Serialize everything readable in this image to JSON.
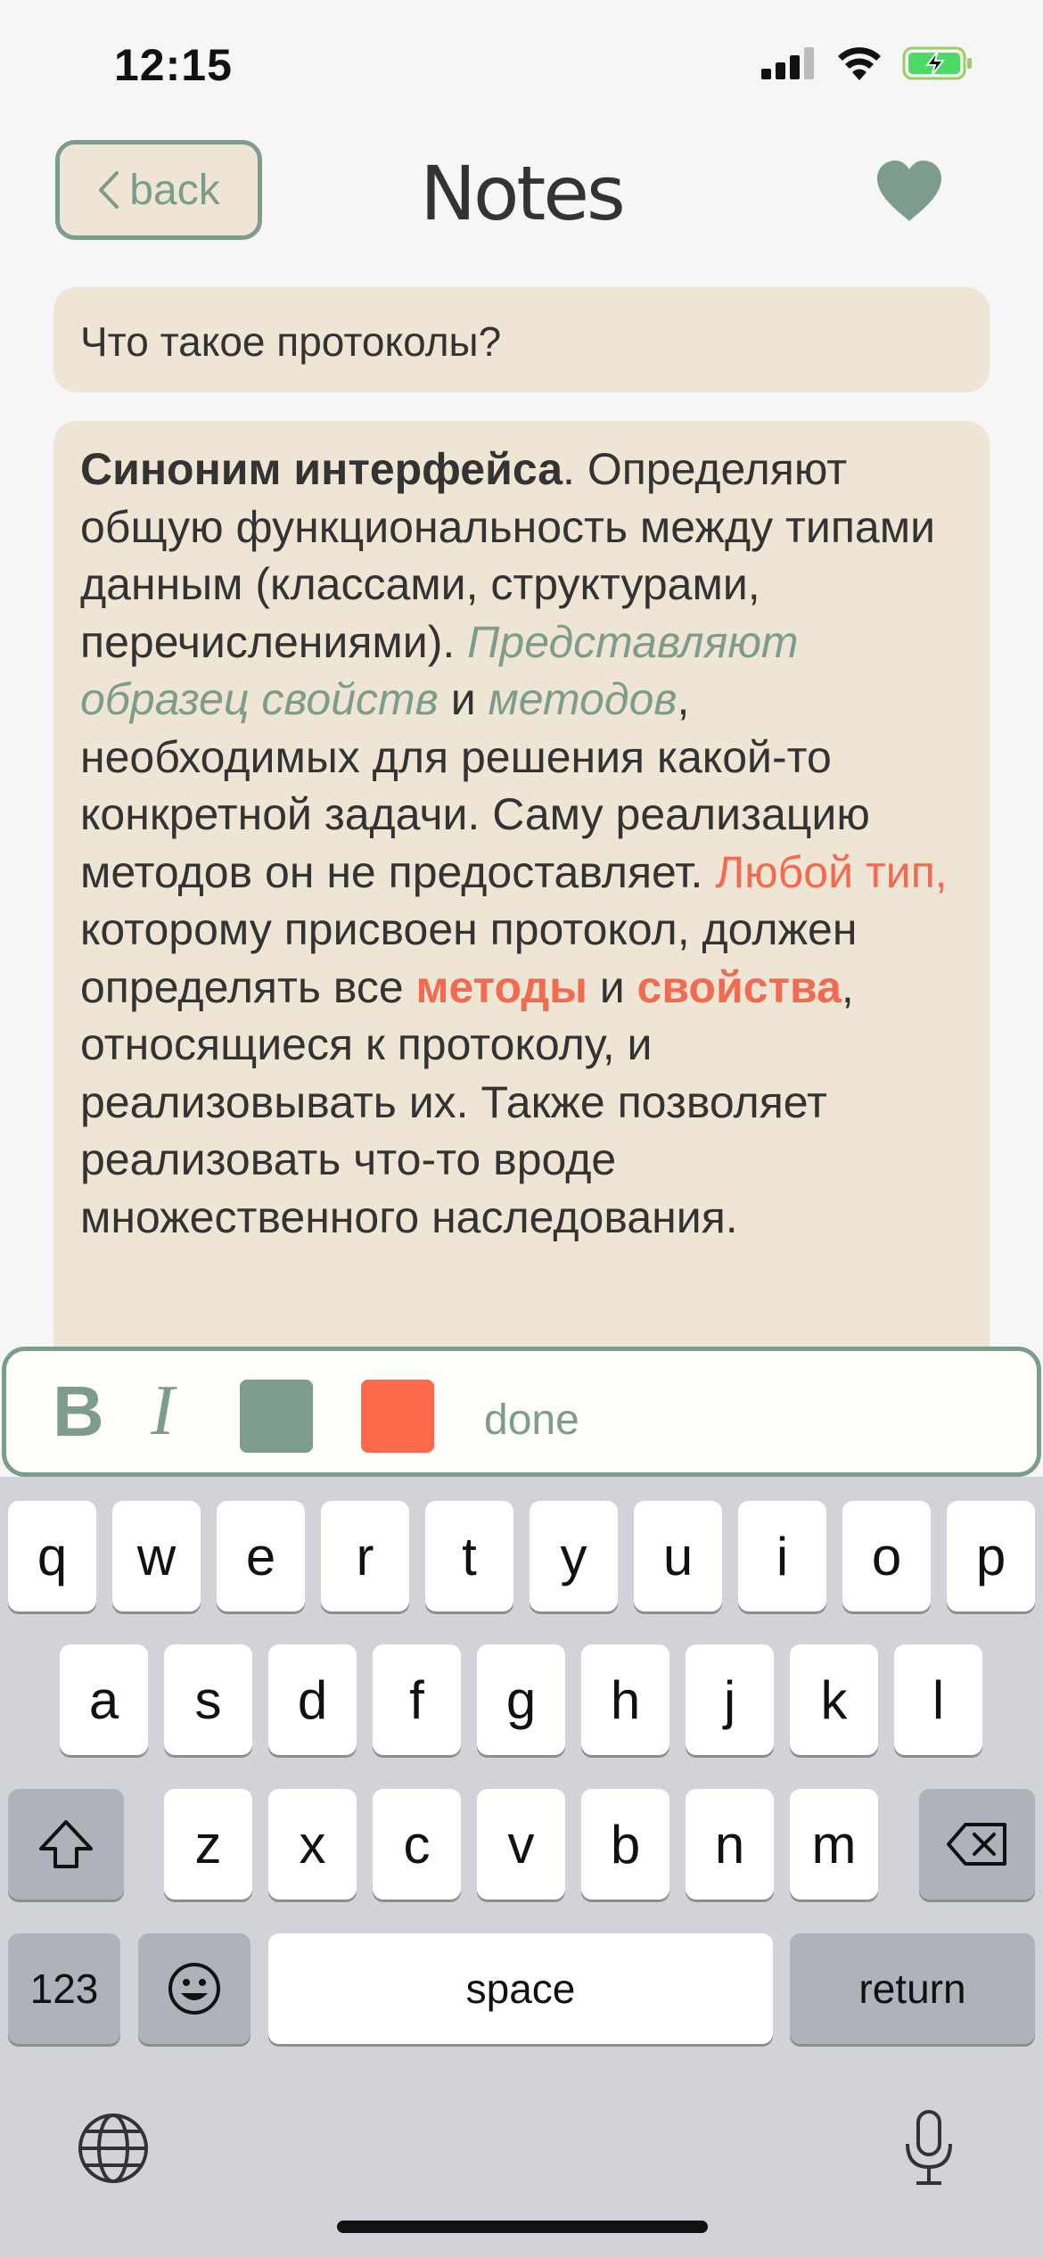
{
  "status_bar": {
    "time": "12:15",
    "icons": [
      "signal-icon",
      "wifi-icon",
      "battery-charging-icon"
    ]
  },
  "header": {
    "back_label": "back",
    "title": "Notes",
    "favorite_icon": "heart-icon"
  },
  "colors": {
    "accent_green": "#7d9c8b",
    "accent_red": "#fe6a4b",
    "card_bg": "#efe5d5"
  },
  "note": {
    "question": "Что такое протоколы?",
    "answer": {
      "s1_bold": "Синоним интерфейса",
      "s2": ". Определяют общую функциональность между типами данным (классами, структурами, перечислениями). ",
      "s3_green_italic": "Представляют образец свойств",
      "s4": " и ",
      "s5_green_italic": "методов",
      "s6": ", необходимых для решения какой-то конкретной задачи. Саму реализацию методов он не предоставляет. ",
      "s7_red": "Любой тип,",
      "s8": " которому присвоен протокол, должен определять все ",
      "s9_red_bold": "методы",
      "s10": " и ",
      "s11_red_bold": "свойства",
      "s12": ", относящиеся к протоколу, и реализовывать их. Также позволяет реализовать что-то вроде множественного наследования."
    }
  },
  "toolbar": {
    "bold_label": "B",
    "italic_label": "I",
    "done_label": "done"
  },
  "keyboard": {
    "row1": [
      "q",
      "w",
      "e",
      "r",
      "t",
      "y",
      "u",
      "i",
      "o",
      "p"
    ],
    "row2": [
      "a",
      "s",
      "d",
      "f",
      "g",
      "h",
      "j",
      "k",
      "l"
    ],
    "row3": [
      "z",
      "x",
      "c",
      "v",
      "b",
      "n",
      "m"
    ],
    "numbers_label": "123",
    "space_label": "space",
    "return_label": "return"
  }
}
